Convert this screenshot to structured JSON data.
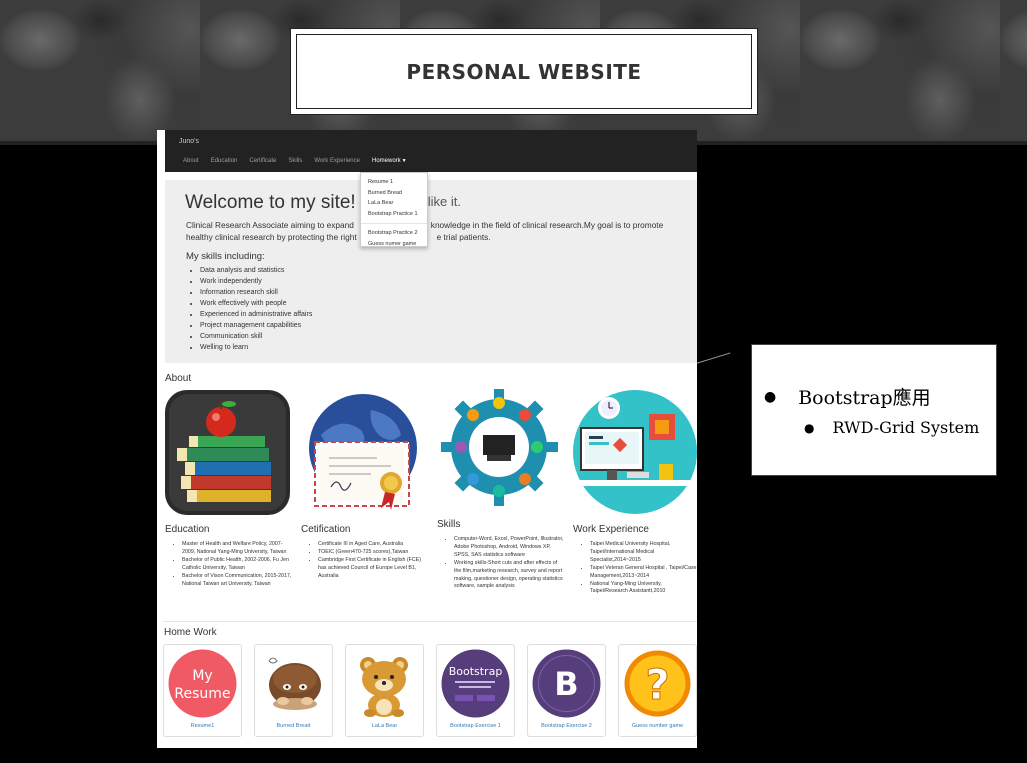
{
  "slide": {
    "title": "PERSONAL WEBSITE",
    "callout": {
      "level1": "Bootstrap應用",
      "level2": "RWD-Grid System"
    }
  },
  "site": {
    "brand": "Juno's",
    "nav": [
      "About",
      "Education",
      "Certificate",
      "Skills",
      "Work Experience",
      "Homework"
    ],
    "dropdown": [
      "Resume 1",
      "Burned Bread",
      "LaLa Bear",
      "Bootstrap Practice 1",
      "Bootstrap Practice 2",
      "Guess numer game"
    ],
    "jumbotron": {
      "title": "Welcome to my site!",
      "title_tail": "like it.",
      "intro_line1": "Clinical Research Associate aiming to expand",
      "intro_line1_tail": "d knowledge in the field of clinical research.My goal is to promote",
      "intro_line2": "healthy clinical research by protecting the right",
      "intro_line2_tail": "e trial patients.",
      "skills_heading": "My skills including:",
      "skills": [
        "Data analysis and statistics",
        "Work independently",
        "Information research skill",
        "Work effectively with people",
        "Experienced in administrative affairs",
        "Project management capabilities",
        "Communication skill",
        "Welling to learn"
      ]
    },
    "about_heading": "About",
    "cards": [
      {
        "title": "Education",
        "items": [
          "Master of Health and Welfare Policy, 2007-2009, National Yang-Ming University, Taiwan",
          "Bachelor of Public Health, 2002-2006, Fu Jen Catholic University, Taiwan",
          "Bachelor of Vison Communication, 2015-2017, National Taiwan art University, Taiwan"
        ]
      },
      {
        "title": "Cetification",
        "items": [
          "Certificate III in Aged Care, Australia",
          "TOEIC (Green470-725 scores),Taiwan",
          "Cambridge First Certificate in English (FCE) has achieved Council of Europe Level B1, Australia"
        ]
      },
      {
        "title": "Skills",
        "items": [
          "Computer-Word, Excel, PowerPoint, Illustrator, Adobe Photoshop, Android, Windows XP, SPSS, SAS statistics software",
          "Working skills-Short cuts and after effects of the film,marketing research, survey and report making, questioner design, operating statistics software, sample analysis"
        ]
      },
      {
        "title": "Work Experience",
        "items": [
          "Taipei Medical University Hospital, Taipei/International Medical Specialist,2014~2015",
          "Taipei Veteran General Hospital , Taipei/Case Management,2013~2014",
          "National Yang-Ming University, Taipei/Research Assistantt,2010"
        ]
      }
    ],
    "homework_heading": "Home Work",
    "homework": [
      {
        "caption": "Resume1",
        "art": "My Resume"
      },
      {
        "caption": "Burned Bread"
      },
      {
        "caption": "LaLa Bear"
      },
      {
        "caption": "Bootstrap Exercise 1",
        "art": "Bootstrap"
      },
      {
        "caption": "Bootstrap Exercise 2",
        "art": "B"
      },
      {
        "caption": "Guess number game",
        "art": "?"
      }
    ]
  }
}
